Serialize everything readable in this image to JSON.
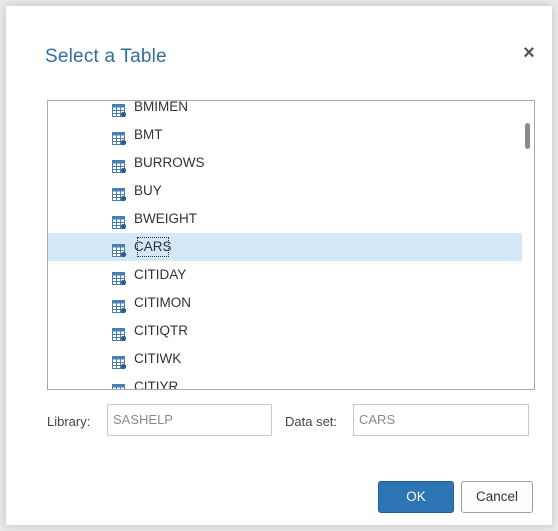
{
  "dialog": {
    "title": "Select a Table",
    "close_label": "×"
  },
  "tables": [
    {
      "name": "BMIMEN",
      "selected": false
    },
    {
      "name": "BMT",
      "selected": false
    },
    {
      "name": "BURROWS",
      "selected": false
    },
    {
      "name": "BUY",
      "selected": false
    },
    {
      "name": "BWEIGHT",
      "selected": false
    },
    {
      "name": "CARS",
      "selected": true
    },
    {
      "name": "CITIDAY",
      "selected": false
    },
    {
      "name": "CITIMON",
      "selected": false
    },
    {
      "name": "CITIQTR",
      "selected": false
    },
    {
      "name": "CITIWK",
      "selected": false
    },
    {
      "name": "CITIYR",
      "selected": false
    }
  ],
  "fields": {
    "library_label": "Library:",
    "library_value": "SASHELP",
    "dataset_label": "Data set:",
    "dataset_value": "CARS"
  },
  "buttons": {
    "ok_label": "OK",
    "cancel_label": "Cancel"
  },
  "colors": {
    "title": "#2f6f9f",
    "selection": "#d5e8f7",
    "primary_button": "#2d74b5",
    "table_icon": "#4a7fae"
  },
  "icons": {
    "table": "table-icon",
    "close": "close-icon"
  }
}
